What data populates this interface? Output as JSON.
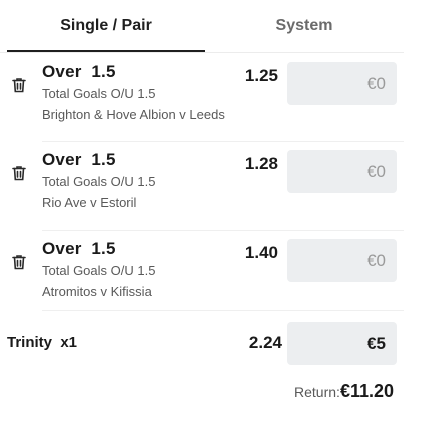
{
  "tabs": [
    {
      "label": "Single / Pair",
      "active": true
    },
    {
      "label": "System",
      "active": false
    }
  ],
  "bets": [
    {
      "selection": "Over  1.5",
      "market": "Total Goals O/U 1.5",
      "event": "Brighton & Hove Albion v Leeds",
      "odds": "1.25",
      "stake": "€0"
    },
    {
      "selection": "Over  1.5",
      "market": "Total Goals O/U 1.5",
      "event": "Rio Ave v Estoril",
      "odds": "1.28",
      "stake": "€0"
    },
    {
      "selection": "Over  1.5",
      "market": "Total Goals O/U 1.5",
      "event": "Atromitos v Kifissia",
      "odds": "1.40",
      "stake": "€0"
    }
  ],
  "combo": {
    "label": "Trinity  x1",
    "odds": "2.24",
    "stake": "€5"
  },
  "returns": {
    "label": "Return:",
    "value": "€11.20"
  },
  "colors": {
    "accent": "#1f1f1f",
    "input_bg": "#eceef0",
    "muted_text": "#595959"
  }
}
